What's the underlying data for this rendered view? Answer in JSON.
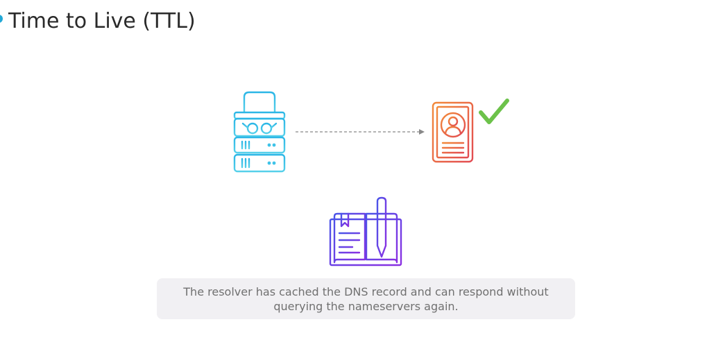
{
  "header": {
    "title": "Time to Live (TTL)",
    "accent_color": "#22a8d6"
  },
  "diagram": {
    "nodes": [
      {
        "id": "resolver",
        "icon": "server-with-glasses-icon",
        "color": "#3ec3e8"
      },
      {
        "id": "dns-record",
        "icon": "id-card-icon",
        "color": "#ec6a3a"
      },
      {
        "id": "verified",
        "icon": "checkmark-icon",
        "color": "#6cc24a"
      },
      {
        "id": "nameservers-log",
        "icon": "book-with-pen-icon",
        "color": "#6a3df0"
      }
    ],
    "edges": [
      {
        "from": "resolver",
        "to": "dns-record",
        "style": "dashed-arrow",
        "color": "#888888"
      }
    ]
  },
  "caption": {
    "text": "The resolver has cached the DNS record and can respond without querying the nameservers again."
  }
}
